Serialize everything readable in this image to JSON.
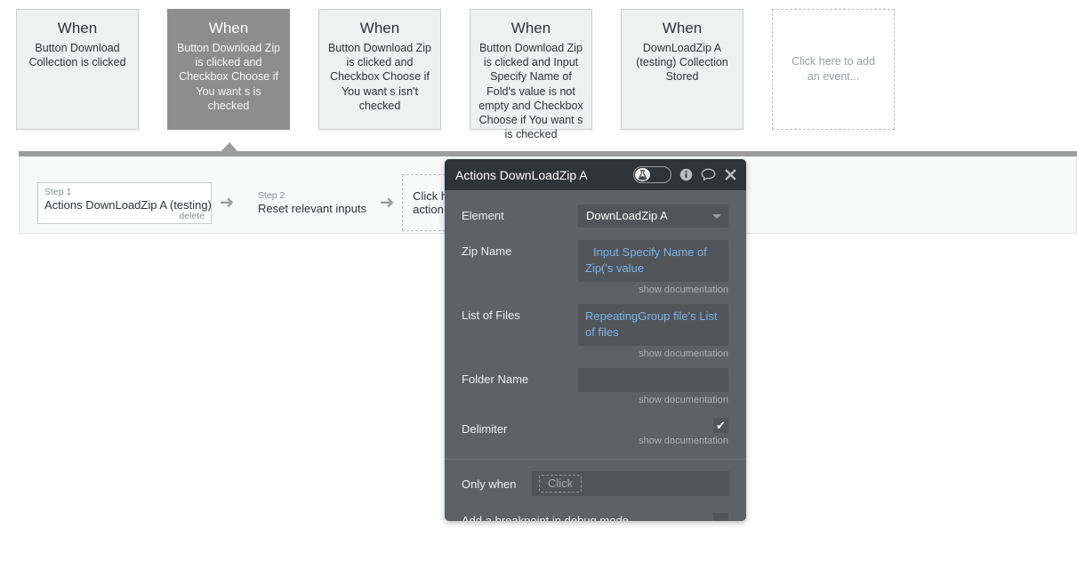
{
  "events": [
    {
      "when_label": "When",
      "description": "Button Download Collection is clicked",
      "selected": false
    },
    {
      "when_label": "When",
      "description": "Button Download Zip is clicked and Checkbox Choose if You want s is checked",
      "selected": true
    },
    {
      "when_label": "When",
      "description": "Button Download Zip is clicked and Checkbox Choose if You want s isn't checked",
      "selected": false
    },
    {
      "when_label": "When",
      "description": "Button Download Zip is clicked and Input Specify Name of Fold's value is not empty and Checkbox Choose if You want s is checked",
      "selected": false
    },
    {
      "when_label": "When",
      "description": "DownLoadZip A (testing) Collection Stored",
      "selected": false
    }
  ],
  "add_event_placeholder": "Click here to add an event...",
  "workflow": {
    "steps": [
      {
        "label": "Step 1",
        "title": "Actions DownLoadZip A (testing)",
        "delete_label": "delete"
      },
      {
        "label": "Step 2",
        "title": "Reset relevant inputs",
        "delete_label": ""
      }
    ],
    "arrow_glyph": "➜",
    "add_step_placeholder": "Click here to add an action..."
  },
  "panel": {
    "title": "Actions DownLoadZip A",
    "toggle_icon": "flask-icon",
    "info_icon": "info-icon",
    "comment_icon": "comment-icon",
    "close_icon": "close-icon",
    "fields": [
      {
        "label": "Element",
        "type": "dropdown",
        "value": "DownLoadZip A",
        "doc_label": ""
      },
      {
        "label": "Zip Name",
        "type": "dynamic",
        "value": "Input Specify Name of Zip('s value",
        "doc_label": "show documentation"
      },
      {
        "label": "List of Files",
        "type": "dynamic",
        "value": "RepeatingGroup file's List of files",
        "doc_label": "show documentation"
      },
      {
        "label": "Folder Name",
        "type": "empty",
        "value": "",
        "doc_label": "show documentation"
      },
      {
        "label": "Delimiter",
        "type": "checkbox",
        "checked": true,
        "check_glyph": "✔",
        "doc_label": "show documentation"
      }
    ],
    "only_when": {
      "label": "Only when",
      "placeholder": "Click"
    },
    "breakpoint": {
      "label": "Add a breakpoint in debug mode",
      "checked": false
    }
  },
  "colors": {
    "panel_bg": "#5c6266",
    "panel_header_bg": "#2e3539",
    "field_bg": "#4f5559",
    "dynamic_text": "#7fb2e5",
    "selected_event_bg": "#8d8d8d",
    "event_bg": "#eff0f0",
    "workflow_bar": "#9d9d9d"
  }
}
